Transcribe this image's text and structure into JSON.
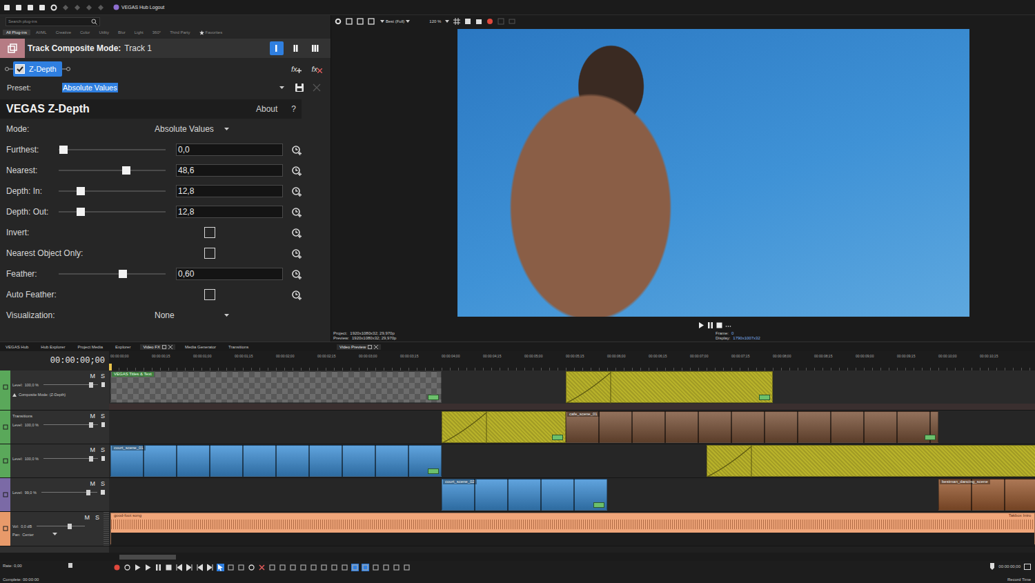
{
  "topbar": {
    "hub": "VEGAS Hub Logout"
  },
  "plugins": {
    "search_placeholder": "Search plug-ins",
    "tabs": [
      {
        "label": "All Plug-ins",
        "selected": true
      },
      {
        "label": "AI/ML",
        "selected": false
      },
      {
        "label": "Creative",
        "selected": false
      },
      {
        "label": "Color",
        "selected": false
      },
      {
        "label": "Utility",
        "selected": false
      },
      {
        "label": "Blur",
        "selected": false
      },
      {
        "label": "Light",
        "selected": false
      },
      {
        "label": "360°",
        "selected": false
      },
      {
        "label": "Third Party",
        "selected": false
      },
      {
        "label": "Favorites",
        "selected": false
      }
    ]
  },
  "composite": {
    "label": "Track Composite Mode:",
    "track": "Track 1",
    "modes": [
      {
        "selected": true
      },
      {
        "selected": false
      },
      {
        "selected": false
      }
    ]
  },
  "chain": {
    "fx": [
      {
        "name": "Z-Depth",
        "checked": true,
        "selected": true
      }
    ],
    "buttons": [
      {
        "label": "fx",
        "kind": "add"
      },
      {
        "label": "fx",
        "kind": "remove"
      }
    ]
  },
  "preset": {
    "label": "Preset:",
    "value": "Absolute Values"
  },
  "plugin": {
    "title": "VEGAS Z-Depth",
    "about": "About",
    "help": "?",
    "params": [
      {
        "kind": "dropdown",
        "label": "Mode:",
        "value": "Absolute Values"
      },
      {
        "kind": "slider",
        "label": "Furthest:",
        "value": "0,0",
        "level": 0.01
      },
      {
        "kind": "slider",
        "label": "Nearest:",
        "value": "48,6",
        "level": 0.64
      },
      {
        "kind": "slider",
        "label": "Depth: In:",
        "value": "12,8",
        "level": 0.18
      },
      {
        "kind": "slider",
        "label": "Depth: Out:",
        "value": "12,8",
        "level": 0.18
      },
      {
        "kind": "checkbox",
        "label": "Invert:",
        "checked": false
      },
      {
        "kind": "checkbox",
        "label": "Nearest Object Only:",
        "checked": false
      },
      {
        "kind": "slider",
        "label": "Feather:",
        "value": "0,60",
        "level": 0.61
      },
      {
        "kind": "checkbox",
        "label": "Auto Feather:",
        "checked": false
      },
      {
        "kind": "dropdown",
        "label": "Visualization:",
        "value": "None"
      }
    ]
  },
  "preview": {
    "quality": "Best (Full)",
    "zoom": "120 %",
    "tab": "Video Preview",
    "info_left": [
      {
        "label": "Project:",
        "value": "1920x1080x32; 29,970p"
      },
      {
        "label": "Preview:",
        "value": "1920x1080x32; 29,970p"
      }
    ],
    "info_right": [
      {
        "label": "Frame:",
        "value": "0"
      },
      {
        "label": "Display:",
        "value": "1790x1007x32"
      }
    ]
  },
  "dock_tabs": [
    {
      "label": "VEGAS Hub",
      "selected": false,
      "closable": false
    },
    {
      "label": "Hub Explorer",
      "selected": false,
      "closable": false
    },
    {
      "label": "Project Media",
      "selected": false,
      "closable": false
    },
    {
      "label": "Explorer",
      "selected": false,
      "closable": false
    },
    {
      "label": "Video FX",
      "selected": true,
      "closable": true
    },
    {
      "label": "Media Generator",
      "selected": false,
      "closable": false
    },
    {
      "label": "Transitions",
      "selected": false,
      "closable": false
    }
  ],
  "timeline": {
    "timecode": "00:00:00;00",
    "ruler": [
      "00:00:00;00",
      "00:00:00;15",
      "00:00:01;00",
      "00:00:01;15",
      "00:00:02;00",
      "00:00:02;15",
      "00:00:03;00",
      "00:00:03;15",
      "00:00:04;00",
      "00:00:04;15",
      "00:00:05;00",
      "00:00:05;15",
      "00:00:06;00",
      "00:00:06;15",
      "00:00:07;00",
      "00:00:07;15",
      "00:00:08;00",
      "00:00:08;15",
      "00:00:09;00",
      "00:00:09;15",
      "00:00:10;00",
      "00:00:10;15"
    ],
    "tracks": [
      {
        "kind": "video",
        "color": "#5aa85a",
        "mute": "M",
        "solo": "S",
        "level_label": "Level:",
        "level_value": "100,0 %",
        "level": 0.7,
        "sublabel": "Composite Mode: (Z-Depth)",
        "clips": [
          {
            "kind": "title",
            "label": "VEGAS Titles & Text",
            "start": 0,
            "end": 4
          },
          {
            "kind": "solid",
            "start": 5.5,
            "end": 8
          }
        ]
      },
      {
        "kind": "video",
        "color": "#5aa85a",
        "mute": "M",
        "solo": "S",
        "name": "Transitions",
        "level_label": "Level:",
        "level_value": "100,0 %",
        "level": 0.7,
        "clips": [
          {
            "kind": "solid",
            "start": 4,
            "end": 5.5
          },
          {
            "kind": "video",
            "label": "cafe_scene_01",
            "color": "#7a5238",
            "start": 5.5,
            "end": 10
          }
        ]
      },
      {
        "kind": "video",
        "color": "#5aa85a",
        "mute": "M",
        "solo": "S",
        "level_label": "Level:",
        "level_value": "100,0 %",
        "level": 0.7,
        "clips": [
          {
            "kind": "video",
            "label": "court_scene_01",
            "color": "#3d8fd6",
            "start": 0,
            "end": 4
          },
          {
            "kind": "solid",
            "start": 7.2,
            "end": 11.5
          }
        ]
      },
      {
        "kind": "video",
        "color": "#7b6aa6",
        "mute": "M",
        "solo": "S",
        "level_label": "Level:",
        "level_value": "99,0 %",
        "level": 0.69,
        "clips": [
          {
            "kind": "video",
            "label": "court_scene_02",
            "color": "#3d8fd6",
            "start": 4,
            "end": 6
          },
          {
            "kind": "video",
            "label": "bestman_dancing_scene",
            "color": "#9a5a30",
            "start": 10,
            "end": 11.5
          }
        ]
      },
      {
        "kind": "audio",
        "color": "#e89a6a",
        "mute": "M",
        "solo": "S",
        "vol_label": "Vol:",
        "vol_value": "0,0 dB",
        "level": 0.7,
        "pan_label": "Pan:",
        "pan_value": "Center",
        "clips": [
          {
            "kind": "audio",
            "label": "good-foot song",
            "end_label": "Takbox Intro",
            "start": 0,
            "end": 11.17
          }
        ]
      }
    ]
  },
  "status": {
    "rate": "Rate: 0,00",
    "complete": "Complete: 00:00:00",
    "time": "00:00:00;00",
    "record": "Record Time"
  }
}
